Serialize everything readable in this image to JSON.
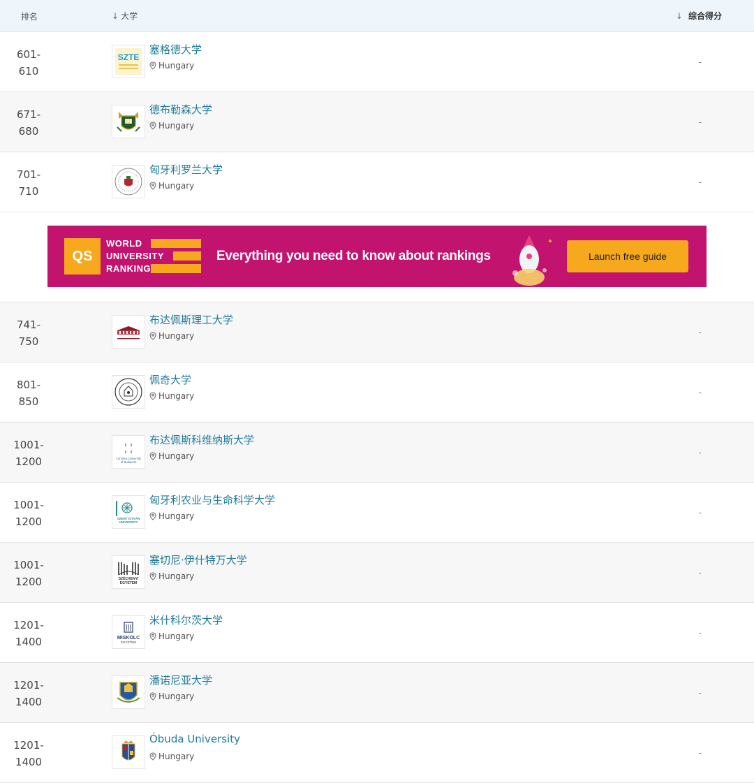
{
  "header": {
    "rank_label": "排名",
    "university_label": "大学",
    "score_label": "综合得分",
    "sort_arrow": "↓"
  },
  "rows_top": [
    {
      "rank_start": "601-",
      "rank_end": "610",
      "name": "塞格德大学",
      "country": "Hungary",
      "score": "-",
      "logo": "szte-logo"
    },
    {
      "rank_start": "671-",
      "rank_end": "680",
      "name": "德布勒森大学",
      "country": "Hungary",
      "score": "-",
      "logo": "debrecen-crest"
    },
    {
      "rank_start": "701-",
      "rank_end": "710",
      "name": "匈牙利罗兰大学",
      "country": "Hungary",
      "score": "-",
      "logo": "elte-seal"
    }
  ],
  "ad": {
    "qs_mark": "QS",
    "line1": "WORLD",
    "line2": "UNIVERSITY",
    "line3": "RANKINGS",
    "tagline": "Everything you need to know about rankings",
    "cta": "Launch free guide"
  },
  "rows_bottom": [
    {
      "rank_start": "741-",
      "rank_end": "750",
      "name": "布达佩斯理工大学",
      "country": "Hungary",
      "score": "-",
      "logo": "bme-building"
    },
    {
      "rank_start": "801-",
      "rank_end": "850",
      "name": "佩奇大学",
      "country": "Hungary",
      "score": "-",
      "logo": "pecs-seal"
    },
    {
      "rank_start": "1001-",
      "rank_end": "1200",
      "name": "布达佩斯科维纳斯大学",
      "country": "Hungary",
      "score": "-",
      "logo": "corvinus-logo",
      "logo_text": "Corvinus University of Budapest"
    },
    {
      "rank_start": "1001-",
      "rank_end": "1200",
      "name": "匈牙利农业与生命科学大学",
      "country": "Hungary",
      "score": "-",
      "logo": "szent-istvan-logo",
      "logo_text": "SZENT ISTVÁN UNIVERSITY"
    },
    {
      "rank_start": "1001-",
      "rank_end": "1200",
      "name": "塞切尼·伊什特万大学",
      "country": "Hungary",
      "score": "-",
      "logo": "szechenyi-logo",
      "logo_text": "SZÉCHENYI EGYETEM"
    },
    {
      "rank_start": "1201-",
      "rank_end": "1400",
      "name": "米什科尔茨大学",
      "country": "Hungary",
      "score": "-",
      "logo": "miskolc-logo",
      "logo_text": "MISKOLC EGYETEM"
    },
    {
      "rank_start": "1201-",
      "rank_end": "1400",
      "name": "潘诺尼亚大学",
      "country": "Hungary",
      "score": "-",
      "logo": "pannonia-crest"
    },
    {
      "rank_start": "1201-",
      "rank_end": "1400",
      "name": "Óbuda University",
      "country": "Hungary",
      "score": "-",
      "logo": "obuda-crest"
    }
  ],
  "colors": {
    "link": "#1f7a98",
    "banner": "#c2136e",
    "accent": "#f6a91c",
    "header_bg": "#eef6fb"
  }
}
